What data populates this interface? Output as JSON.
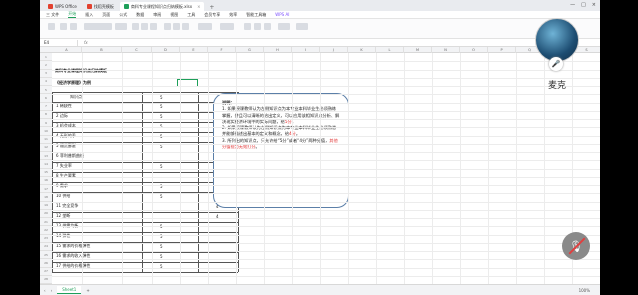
{
  "tabs": [
    {
      "label": "WPS Office",
      "icon": "wps-icon",
      "active": false
    },
    {
      "label": "找稻壳模板",
      "icon": "pdf-icon",
      "active": false
    },
    {
      "label": "商科专业课程知识点归纳模板.xlsx",
      "icon": "xls-icon",
      "active": true
    }
  ],
  "menu": [
    "三 文件",
    "开始",
    "插入",
    "页面",
    "公式",
    "数据",
    "审阅",
    "视图",
    "工具",
    "会员专享",
    "效率",
    "智能工具箱",
    "WPS AI"
  ],
  "menu_active": "开始",
  "formula": {
    "name_box": "E4",
    "fx": "fx"
  },
  "columns": [
    "A",
    "B",
    "C",
    "D",
    "E",
    "F",
    "G",
    "H",
    "I",
    "J",
    "K",
    "L",
    "M",
    "N",
    "O",
    "P",
    "Q",
    "R",
    "S"
  ],
  "rows": [
    "1",
    "2",
    "3",
    "4",
    "5",
    "6",
    "7",
    "8",
    "9",
    "10",
    "11",
    "12",
    "13",
    "14",
    "15",
    "16",
    "17",
    "18",
    "19",
    "20",
    "21",
    "22",
    "23",
    "24",
    "25",
    "26",
    "27",
    "28"
  ],
  "sheet": {
    "title": "商科专业课程知识点归纳模板",
    "course": "《经济学原理》为例",
    "header": {
      "topic": "知识点",
      "c": "5",
      "d": "4"
    },
    "items": [
      {
        "name": "1 稀缺性",
        "c": "5",
        "d": ""
      },
      {
        "name": "2 边际",
        "c": "5",
        "d": ""
      },
      {
        "name": "3 机会成本",
        "c": "5",
        "d": ""
      },
      {
        "name": "4 无形的手",
        "c": "5",
        "d": ""
      },
      {
        "name": "5 通货膨胀",
        "c": "5",
        "d": ""
      },
      {
        "name": "6 菲利普斯曲线",
        "c": "",
        "d": "4"
      },
      {
        "name": "7 失业率",
        "c": "5",
        "d": ""
      },
      {
        "name": "8 生产要素",
        "c": "",
        "d": "4"
      },
      {
        "name": "9 需求",
        "c": "5",
        "d": ""
      },
      {
        "name": "10 供给",
        "c": "5",
        "d": ""
      },
      {
        "name": "11 完全竞争",
        "c": "",
        "d": "4"
      },
      {
        "name": "12 垄断",
        "c": "",
        "d": "4"
      },
      {
        "name": "13 供需均衡",
        "c": "5",
        "d": ""
      },
      {
        "name": "14 弹性",
        "c": "5",
        "d": ""
      },
      {
        "name": "15 需求的价格弹性",
        "c": "5",
        "d": ""
      },
      {
        "name": "16 需求的收入弹性",
        "c": "5",
        "d": ""
      },
      {
        "name": "17 供给的价格弹性",
        "c": "5",
        "d": ""
      }
    ]
  },
  "note": {
    "title": "说明：",
    "p1a": "1. 如果授课教师认为左侧知识点为本专业本科毕业生必须熟练掌握，并且可以清晰的给出定义，可以应用该相知识点分析、解决现实经济环境中的实际问题，给",
    "p1red": "5分",
    "p1b": "。",
    "p2a": "2. 如果授课教师认为左侧知识点为本专业本科毕业生必须熟悉并能够描述出基本的定义和概念，给",
    "p2red": "4分",
    "p2b": "。",
    "p3a": "3. 所列出的知识点，只允许给“5分”或者“4分”两种分值，",
    "p3red": "其他分值视为无效打分",
    "p3b": "。"
  },
  "sheet_tab": "Sheet1",
  "zoom": "100%",
  "call": {
    "name": "麦克"
  }
}
